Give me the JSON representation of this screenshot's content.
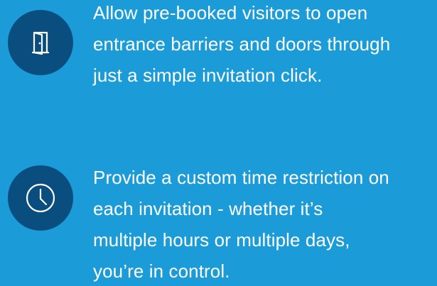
{
  "colors": {
    "background": "#1b9bd7",
    "icon_circle": "#0a4d7f",
    "text": "#ffffff"
  },
  "features": [
    {
      "icon": "door-icon",
      "text": "Allow pre-booked visitors to open\nentrance barriers and doors through\njust a simple invitation click."
    },
    {
      "icon": "clock-icon",
      "text": "Provide a custom time restriction on\neach invitation - whether it’s\nmultiple hours or multiple days,\nyou’re in control."
    }
  ]
}
